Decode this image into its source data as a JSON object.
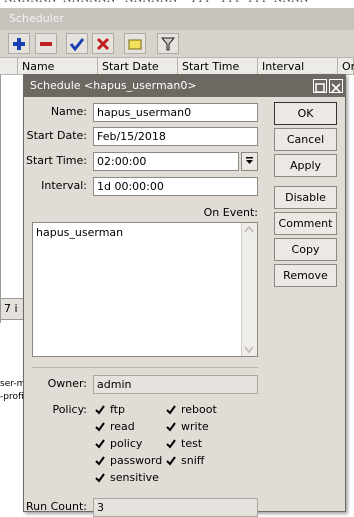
{
  "background": {
    "window_title": "Scheduler",
    "columns": [
      "Name",
      "Start Date",
      "Start Time",
      "Interval",
      "On"
    ],
    "footer_count": "7 i",
    "left_fragments": [
      "ser-m",
      "-profi"
    ]
  },
  "dialog": {
    "title": "Schedule <hapus_userman0>",
    "labels": {
      "name": "Name:",
      "start_date": "Start Date:",
      "start_time": "Start Time:",
      "interval": "Interval:",
      "on_event": "On Event:",
      "owner": "Owner:",
      "policy": "Policy:",
      "run_count": "Run Count:"
    },
    "values": {
      "name": "hapus_userman0",
      "start_date": "Feb/15/2018",
      "start_time": "02:00:00",
      "interval": "1d 00:00:00",
      "on_event": "hapus_userman",
      "owner": "admin",
      "run_count": "3"
    },
    "buttons": {
      "ok": "OK",
      "cancel": "Cancel",
      "apply": "Apply",
      "disable": "Disable",
      "comment": "Comment",
      "copy": "Copy",
      "remove": "Remove"
    },
    "policies_left": [
      "ftp",
      "read",
      "policy",
      "password",
      "sensitive"
    ],
    "policies_right": [
      "reboot",
      "write",
      "test",
      "sniff"
    ]
  }
}
